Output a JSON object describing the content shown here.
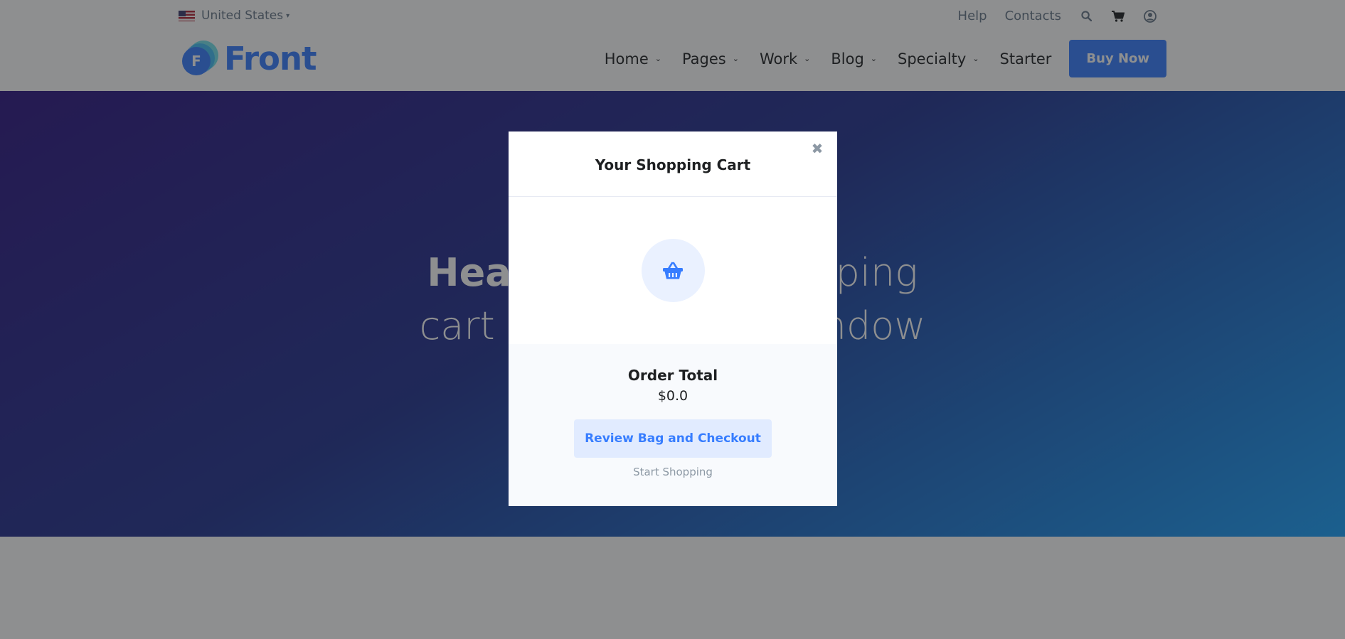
{
  "topbar": {
    "country": "United States",
    "links": [
      "Help",
      "Contacts"
    ],
    "icons": [
      "search-icon",
      "cart-icon",
      "user-icon"
    ]
  },
  "brand": {
    "name": "Front",
    "mark_letter": "F"
  },
  "nav": {
    "items": [
      "Home",
      "Pages",
      "Work",
      "Blog",
      "Specialty",
      "Starter"
    ],
    "cta": "Buy Now"
  },
  "hero": {
    "line1_bold": "Hea",
    "line1_rest": "ping",
    "line2_start": "cart",
    "line2_end": "ndow"
  },
  "modal": {
    "title": "Your Shopping Cart",
    "close_glyph": "✖",
    "order_total_label": "Order Total",
    "order_total_value": "$0.0",
    "review_button": "Review Bag and Checkout",
    "start_link": "Start Shopping"
  },
  "colors": {
    "primary": "#377dff",
    "text_dark": "#1e2022",
    "text_muted": "#677788",
    "backdrop": "rgba(30,32,34,0.5)"
  }
}
